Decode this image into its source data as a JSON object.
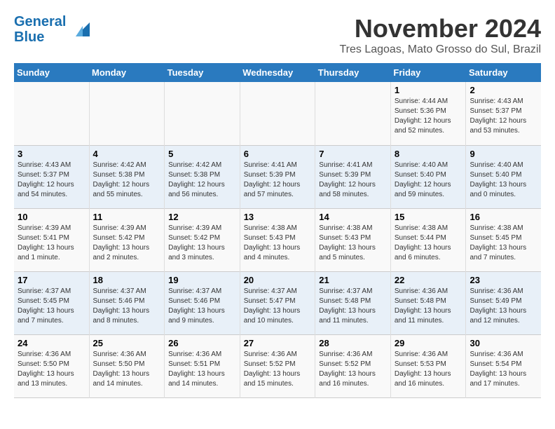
{
  "header": {
    "logo_line1": "General",
    "logo_line2": "Blue",
    "month_title": "November 2024",
    "location": "Tres Lagoas, Mato Grosso do Sul, Brazil"
  },
  "weekdays": [
    "Sunday",
    "Monday",
    "Tuesday",
    "Wednesday",
    "Thursday",
    "Friday",
    "Saturday"
  ],
  "weeks": [
    [
      {
        "day": "",
        "info": ""
      },
      {
        "day": "",
        "info": ""
      },
      {
        "day": "",
        "info": ""
      },
      {
        "day": "",
        "info": ""
      },
      {
        "day": "",
        "info": ""
      },
      {
        "day": "1",
        "info": "Sunrise: 4:44 AM\nSunset: 5:36 PM\nDaylight: 12 hours\nand 52 minutes."
      },
      {
        "day": "2",
        "info": "Sunrise: 4:43 AM\nSunset: 5:37 PM\nDaylight: 12 hours\nand 53 minutes."
      }
    ],
    [
      {
        "day": "3",
        "info": "Sunrise: 4:43 AM\nSunset: 5:37 PM\nDaylight: 12 hours\nand 54 minutes."
      },
      {
        "day": "4",
        "info": "Sunrise: 4:42 AM\nSunset: 5:38 PM\nDaylight: 12 hours\nand 55 minutes."
      },
      {
        "day": "5",
        "info": "Sunrise: 4:42 AM\nSunset: 5:38 PM\nDaylight: 12 hours\nand 56 minutes."
      },
      {
        "day": "6",
        "info": "Sunrise: 4:41 AM\nSunset: 5:39 PM\nDaylight: 12 hours\nand 57 minutes."
      },
      {
        "day": "7",
        "info": "Sunrise: 4:41 AM\nSunset: 5:39 PM\nDaylight: 12 hours\nand 58 minutes."
      },
      {
        "day": "8",
        "info": "Sunrise: 4:40 AM\nSunset: 5:40 PM\nDaylight: 12 hours\nand 59 minutes."
      },
      {
        "day": "9",
        "info": "Sunrise: 4:40 AM\nSunset: 5:40 PM\nDaylight: 13 hours\nand 0 minutes."
      }
    ],
    [
      {
        "day": "10",
        "info": "Sunrise: 4:39 AM\nSunset: 5:41 PM\nDaylight: 13 hours\nand 1 minute."
      },
      {
        "day": "11",
        "info": "Sunrise: 4:39 AM\nSunset: 5:42 PM\nDaylight: 13 hours\nand 2 minutes."
      },
      {
        "day": "12",
        "info": "Sunrise: 4:39 AM\nSunset: 5:42 PM\nDaylight: 13 hours\nand 3 minutes."
      },
      {
        "day": "13",
        "info": "Sunrise: 4:38 AM\nSunset: 5:43 PM\nDaylight: 13 hours\nand 4 minutes."
      },
      {
        "day": "14",
        "info": "Sunrise: 4:38 AM\nSunset: 5:43 PM\nDaylight: 13 hours\nand 5 minutes."
      },
      {
        "day": "15",
        "info": "Sunrise: 4:38 AM\nSunset: 5:44 PM\nDaylight: 13 hours\nand 6 minutes."
      },
      {
        "day": "16",
        "info": "Sunrise: 4:38 AM\nSunset: 5:45 PM\nDaylight: 13 hours\nand 7 minutes."
      }
    ],
    [
      {
        "day": "17",
        "info": "Sunrise: 4:37 AM\nSunset: 5:45 PM\nDaylight: 13 hours\nand 7 minutes."
      },
      {
        "day": "18",
        "info": "Sunrise: 4:37 AM\nSunset: 5:46 PM\nDaylight: 13 hours\nand 8 minutes."
      },
      {
        "day": "19",
        "info": "Sunrise: 4:37 AM\nSunset: 5:46 PM\nDaylight: 13 hours\nand 9 minutes."
      },
      {
        "day": "20",
        "info": "Sunrise: 4:37 AM\nSunset: 5:47 PM\nDaylight: 13 hours\nand 10 minutes."
      },
      {
        "day": "21",
        "info": "Sunrise: 4:37 AM\nSunset: 5:48 PM\nDaylight: 13 hours\nand 11 minutes."
      },
      {
        "day": "22",
        "info": "Sunrise: 4:36 AM\nSunset: 5:48 PM\nDaylight: 13 hours\nand 11 minutes."
      },
      {
        "day": "23",
        "info": "Sunrise: 4:36 AM\nSunset: 5:49 PM\nDaylight: 13 hours\nand 12 minutes."
      }
    ],
    [
      {
        "day": "24",
        "info": "Sunrise: 4:36 AM\nSunset: 5:50 PM\nDaylight: 13 hours\nand 13 minutes."
      },
      {
        "day": "25",
        "info": "Sunrise: 4:36 AM\nSunset: 5:50 PM\nDaylight: 13 hours\nand 14 minutes."
      },
      {
        "day": "26",
        "info": "Sunrise: 4:36 AM\nSunset: 5:51 PM\nDaylight: 13 hours\nand 14 minutes."
      },
      {
        "day": "27",
        "info": "Sunrise: 4:36 AM\nSunset: 5:52 PM\nDaylight: 13 hours\nand 15 minutes."
      },
      {
        "day": "28",
        "info": "Sunrise: 4:36 AM\nSunset: 5:52 PM\nDaylight: 13 hours\nand 16 minutes."
      },
      {
        "day": "29",
        "info": "Sunrise: 4:36 AM\nSunset: 5:53 PM\nDaylight: 13 hours\nand 16 minutes."
      },
      {
        "day": "30",
        "info": "Sunrise: 4:36 AM\nSunset: 5:54 PM\nDaylight: 13 hours\nand 17 minutes."
      }
    ]
  ]
}
